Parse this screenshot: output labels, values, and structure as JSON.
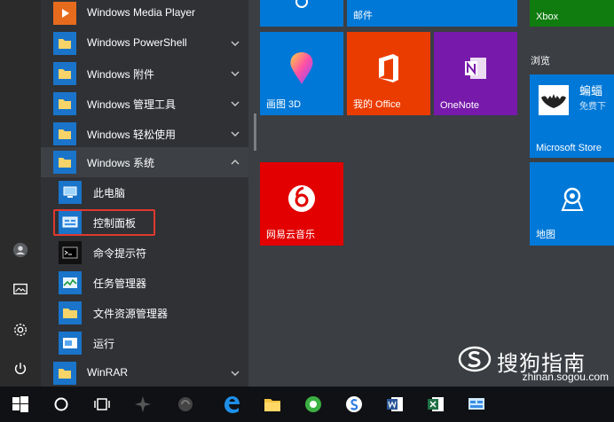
{
  "left_strip": {
    "icons": [
      "user-icon",
      "picture-icon",
      "settings-icon",
      "power-icon"
    ]
  },
  "app_list": {
    "items": [
      {
        "label": "Windows Media Player",
        "kind": "app"
      },
      {
        "label": "Windows PowerShell",
        "kind": "folder",
        "expanded": false
      },
      {
        "label": "Windows 附件",
        "kind": "folder",
        "expanded": false
      },
      {
        "label": "Windows 管理工具",
        "kind": "folder",
        "expanded": false
      },
      {
        "label": "Windows 轻松使用",
        "kind": "folder",
        "expanded": false
      },
      {
        "label": "Windows 系统",
        "kind": "folder",
        "expanded": true
      },
      {
        "label": "此电脑",
        "kind": "subitem"
      },
      {
        "label": "控制面板",
        "kind": "subitem",
        "highlighted": true
      },
      {
        "label": "命令提示符",
        "kind": "subitem"
      },
      {
        "label": "任务管理器",
        "kind": "subitem"
      },
      {
        "label": "文件资源管理器",
        "kind": "subitem"
      },
      {
        "label": "运行",
        "kind": "subitem"
      },
      {
        "label": "WinRAR",
        "kind": "folder",
        "expanded": false
      }
    ],
    "highlight_color": "#e0392f"
  },
  "tiles": {
    "mail": {
      "label": "邮件",
      "color": "#0078d7"
    },
    "xbox": {
      "label": "Xbox",
      "color": "#107c10"
    },
    "paint3d": {
      "label": "画图 3D",
      "color": "#0078d7"
    },
    "office": {
      "label": "我的 Office",
      "color": "#eb3c00"
    },
    "onenote": {
      "label": "OneNote",
      "color": "#7719aa"
    },
    "netease": {
      "label": "网易云音乐",
      "color": "#e20000"
    },
    "browse_section": "浏览",
    "store": {
      "label": "Microsoft Store",
      "color": "#0078d7",
      "promo_title": "蝙蝠",
      "promo_sub": "免费下"
    },
    "maps": {
      "label": "地图",
      "color": "#0078d7"
    }
  },
  "taskbar": {
    "icons": [
      "windows-start-icon",
      "cortana-icon",
      "task-view-icon",
      "app-icon-1",
      "app-icon-2",
      "edge-icon",
      "explorer-icon",
      "browser-icon",
      "sogou-icon",
      "word-icon",
      "excel-icon",
      "control-panel-icon"
    ]
  },
  "watermark": {
    "title": "搜狗指南",
    "url": "zhinan.sogou.com"
  }
}
